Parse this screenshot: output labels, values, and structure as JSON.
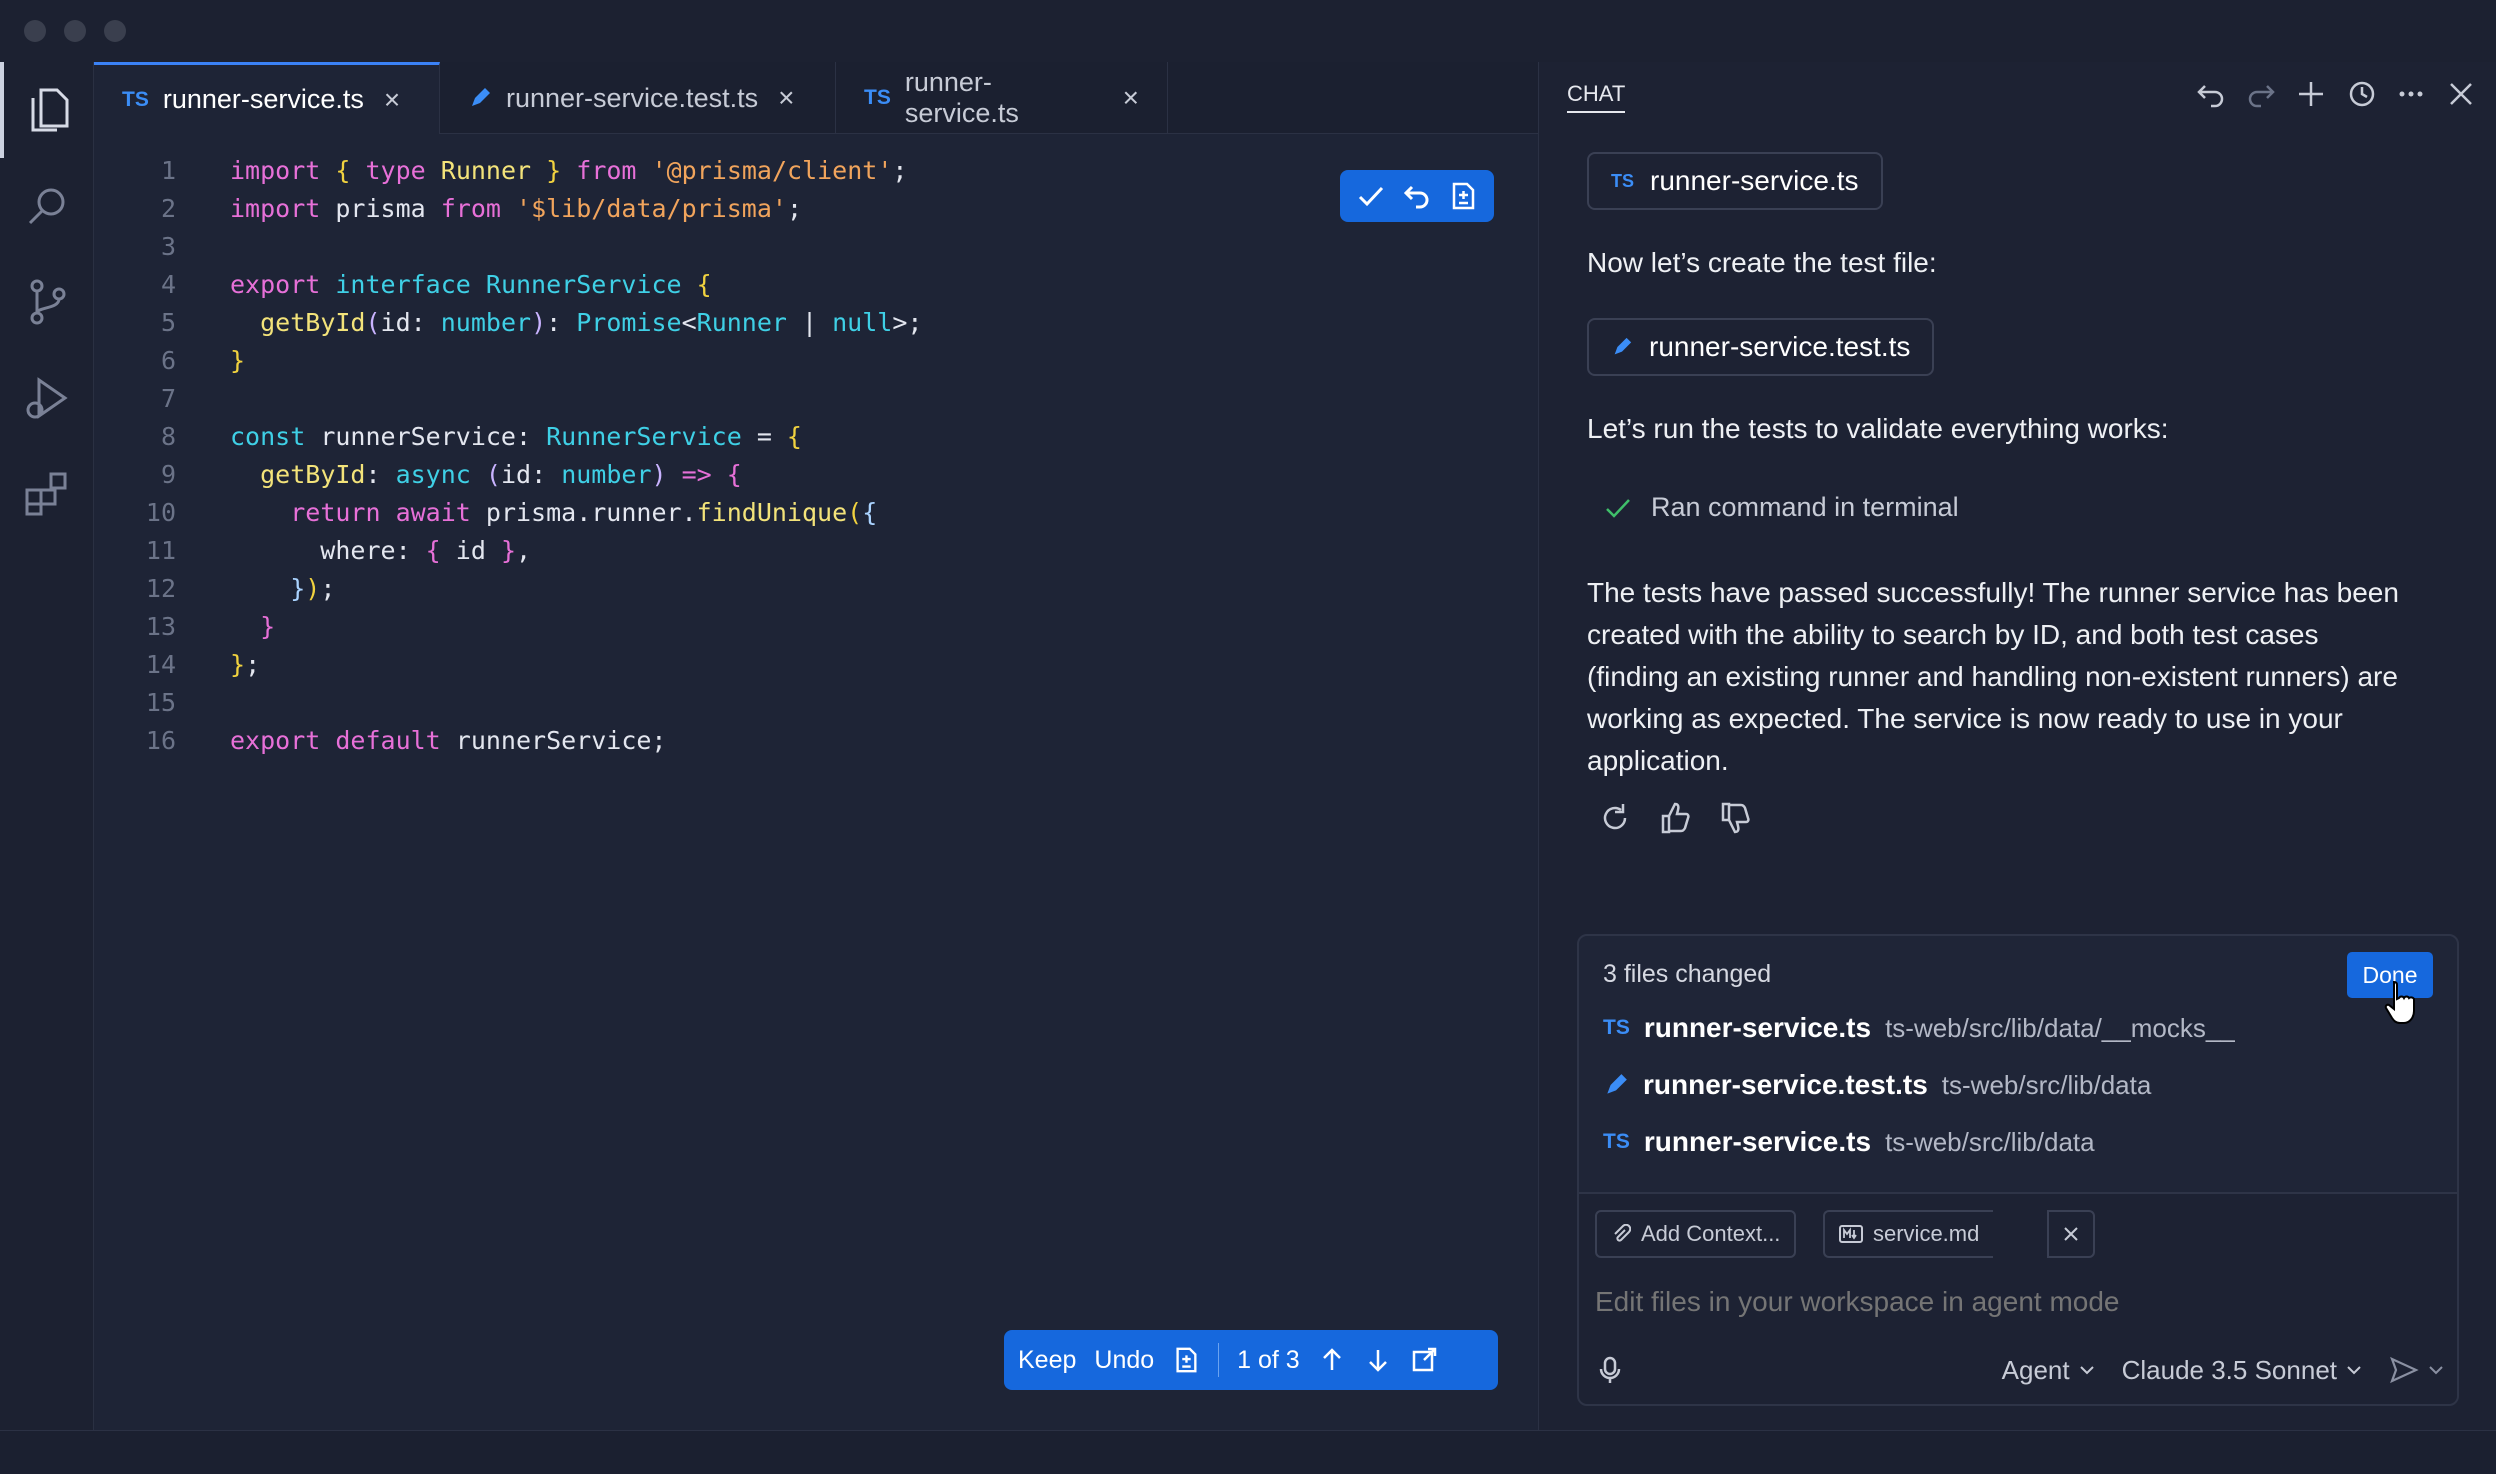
{
  "tabs": [
    {
      "badge": "TS",
      "label": "runner-service.ts",
      "active": true
    },
    {
      "badge": "pen",
      "label": "runner-service.test.ts",
      "active": false
    },
    {
      "badge": "TS",
      "label": "runner-service.ts",
      "active": false
    }
  ],
  "code": {
    "line_numbers": [
      "1",
      "2",
      "3",
      "4",
      "5",
      "6",
      "7",
      "8",
      "9",
      "10",
      "11",
      "12",
      "13",
      "14",
      "15",
      "16"
    ]
  },
  "editor_bottom": {
    "keep": "Keep",
    "undo": "Undo",
    "counter": "1 of 3"
  },
  "chat": {
    "tab": "CHAT",
    "chip1": {
      "badge": "TS",
      "label": "runner-service.ts"
    },
    "msg1": "Now let’s create the test file:",
    "chip2": {
      "label": "runner-service.test.ts"
    },
    "msg2": "Let’s run the tests to validate everything works:",
    "ran": "Ran command in terminal",
    "summary": "The tests have passed successfully! The runner service has been created with the ability to search by ID, and both test cases (finding an existing runner and handling non-existent runners) are working as expected. The service is now ready to use in your application.",
    "changes": {
      "title": "3 files changed",
      "done": "Done",
      "files": [
        {
          "badge": "TS",
          "name": "runner-service.ts",
          "path": "ts-web/src/lib/data/__mocks__"
        },
        {
          "badge": "pen",
          "name": "runner-service.test.ts",
          "path": "ts-web/src/lib/data"
        },
        {
          "badge": "TS",
          "name": "runner-service.ts",
          "path": "ts-web/src/lib/data"
        }
      ]
    },
    "input": {
      "add_context": "Add Context...",
      "attachment": "service.md",
      "placeholder": "Edit files in your workspace in agent mode",
      "mode": "Agent",
      "model": "Claude 3.5 Sonnet"
    }
  },
  "colors": {
    "accent": "#1668dd",
    "keyword": "#e770d8",
    "type": "#3fd0e6",
    "string": "#f1a45c",
    "function": "#f3e37a"
  }
}
